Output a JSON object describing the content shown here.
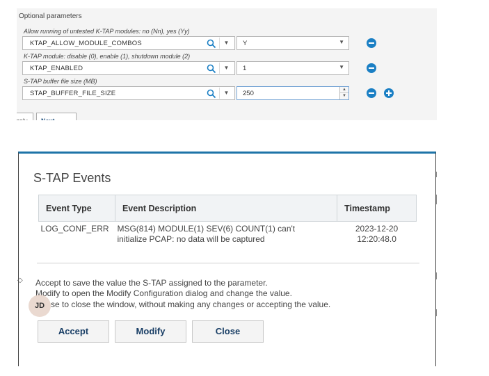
{
  "optional_parameters": {
    "title": "Optional parameters",
    "params": [
      {
        "label": "Allow running of untested K-TAP modules: no (Nn), yes (Yy)",
        "name": "KTAP_ALLOW_MODULE_COMBOS",
        "value": "Y"
      },
      {
        "label": "K-TAP module: disable (0), enable (1), shutdown module (2)",
        "name": "KTAP_ENABLED",
        "value": "1"
      },
      {
        "label": "S-TAP buffer file size (MB)",
        "name": "STAP_BUFFER_FILE_SIZE",
        "value": "250"
      }
    ],
    "apply_label": "pply",
    "next_label": "Next"
  },
  "dialog": {
    "title": "S-TAP Events",
    "columns": [
      "Event Type",
      "Event Description",
      "Timestamp"
    ],
    "rows": [
      {
        "event_type": "LOG_CONF_ERR",
        "description_line1": "MSG(814) MODULE(1) SEV(6) COUNT(1) can't",
        "description_line2": "initialize PCAP: no data will be captured",
        "timestamp_line1": "2023-12-20",
        "timestamp_line2": "12:20:48.0"
      }
    ],
    "help": {
      "accept": "Accept to save the value the S-TAP assigned to the parameter.",
      "modify": "Modify to open the Modify Configuration dialog and change the value.",
      "close": "se to close the window, without making any changes or accepting the value."
    },
    "avatar_initials": "JD",
    "buttons": {
      "accept": "Accept",
      "modify": "Modify",
      "close": "Close"
    }
  },
  "colors": {
    "accent": "#1a7fc4",
    "dialog_border": "#1e74a8"
  }
}
